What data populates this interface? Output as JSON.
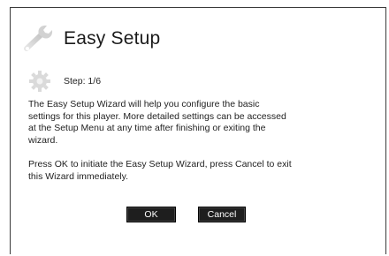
{
  "dialog": {
    "title": "Easy Setup",
    "title_icon": "wrench-icon",
    "step_icon": "gear-icon",
    "step": "Step: 1/6",
    "paragraphs": [
      "The Easy Setup Wizard will help you configure the basic settings for this player.  More detailed settings can be accessed at the Setup Menu at any time after finishing or exiting the wizard.",
      "Press OK to initiate the Easy Setup Wizard, press Cancel to exit this Wizard immediately."
    ],
    "buttons": {
      "ok": "OK",
      "cancel": "Cancel"
    }
  }
}
